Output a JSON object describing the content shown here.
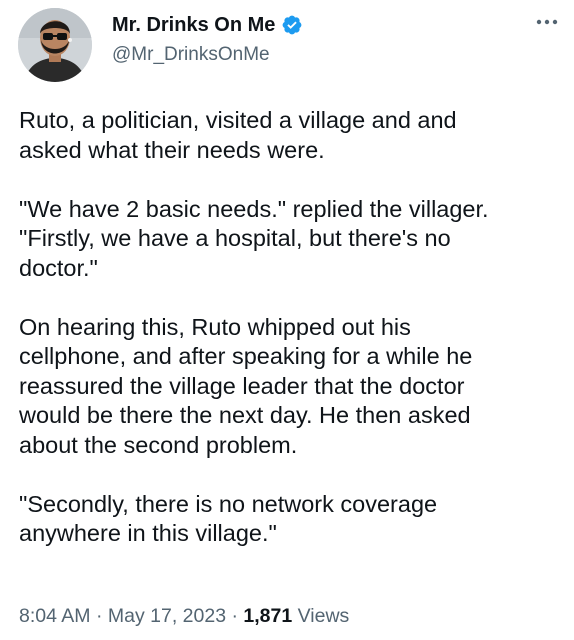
{
  "author": {
    "display_name": "Mr. Drinks On Me",
    "handle": "@Mr_DrinksOnMe",
    "verified": true
  },
  "tweet": {
    "paragraphs": [
      "Ruto, a politician, visited a village and and\nasked what their needs were.",
      "\"We have 2 basic needs.\" replied the villager.\n\"Firstly, we have a hospital, but there's no\ndoctor.\"",
      "On hearing this, Ruto whipped out his\ncellphone, and after speaking for a while he\nreassured the village leader that the doctor\nwould be there the next day. He then asked\nabout the second problem.",
      "\"Secondly, there is no network coverage\nanywhere in this village.\""
    ]
  },
  "meta": {
    "time": "8:04 AM",
    "date": "May 17, 2023",
    "separator": "·",
    "views_count": "1,871",
    "views_label": "Views"
  },
  "colors": {
    "verified_badge": "#1d9bf0",
    "secondary_text": "#536471",
    "primary_text": "#0f1419"
  },
  "icons": {
    "more": "more-horizontal-icon",
    "verified": "verified-badge-icon"
  }
}
